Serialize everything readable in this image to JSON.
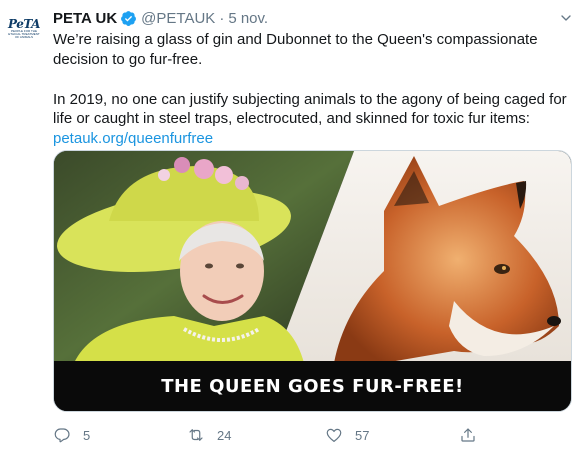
{
  "tweet": {
    "avatar": {
      "logo_text": "PeTA",
      "tagline": "PEOPLE FOR THE ETHICAL TREATMENT OF ANIMALS"
    },
    "display_name": "PETA UK",
    "verified": true,
    "handle": "@PETAUK",
    "separator": "·",
    "date": "5 nov.",
    "paragraph1": "We’re raising a glass of gin and Dubonnet to the Queen's compassionate decision to go fur-free.",
    "paragraph2": "In 2019, no one can justify subjecting animals to the agony of being caged for life or caught in steel traps, electrocuted, and skinned for toxic fur items:",
    "link_text": "petauk.org/queenfurfree",
    "media": {
      "banner_text": "THE QUEEN GOES FUR-FREE!"
    },
    "actions": {
      "reply_count": "5",
      "retweet_count": "24",
      "like_count": "57"
    },
    "icons": {
      "reply": "reply-icon",
      "retweet": "retweet-icon",
      "like": "heart-icon",
      "share": "share-icon",
      "caret": "chevron-down-icon",
      "verified": "verified-badge-icon"
    },
    "colors": {
      "link": "#1b95e0",
      "verified": "#1da1f2",
      "muted": "#657786"
    }
  }
}
